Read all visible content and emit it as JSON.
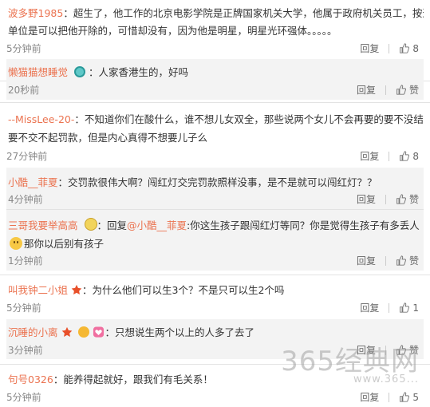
{
  "reply_label": "回复",
  "like_label": "赞",
  "comments": [
    {
      "name": "波多野1985",
      "text": "：超生了，他工作的北京电影学院是正牌国家机关大学，他属于政府机关员工，按道理",
      "text2": "单位是可以把他开除的，可惜却没有，因为他是明星，明星光环强体。。。。。",
      "time": "5分钟前",
      "likes": "8",
      "replies": [
        {
          "name": "懒猫猫想睡觉",
          "text": "：人家香港生的，好吗",
          "time": "20秒前"
        }
      ]
    },
    {
      "name": "--MissLee-20-",
      "text": "：不知道你们在酸什么，谁不想儿女双全，那些说两个女儿不会再要的要不没结婚",
      "text2": "要不交不起罚款，但是内心真得不想要儿子么",
      "time": "27分钟前",
      "likes": "8",
      "replies": [
        {
          "name": "小酷__菲夏",
          "text": "：交罚款很伟大啊？闯红灯交完罚款照样没事，是不是就可以闯红灯？？",
          "time": "4分钟前"
        },
        {
          "name": "三哥我要举高高",
          "text": "：回复",
          "mention": "@小酷__菲夏",
          "text_after": ":你这生孩子跟闯红灯等同？你是觉得生孩子有多丢人",
          "text2": "那你以后别有孩子",
          "time": "1分钟前"
        }
      ]
    },
    {
      "name": "叫我钟二小姐",
      "text": "：为什么他们可以生3个？不是只可以生2个吗",
      "time": "5分钟前",
      "likes": "1",
      "replies": [
        {
          "name": "沉睡的小离",
          "text": "：只想说生两个以上的人多了去了",
          "time": "3分钟前"
        }
      ]
    },
    {
      "name": "句号0326",
      "text": "：能养得起就好，跟我们有毛关系！",
      "time": "5分钟前",
      "likes": "5"
    }
  ],
  "watermark": {
    "text": "365经典网",
    "url": "www.365..."
  }
}
